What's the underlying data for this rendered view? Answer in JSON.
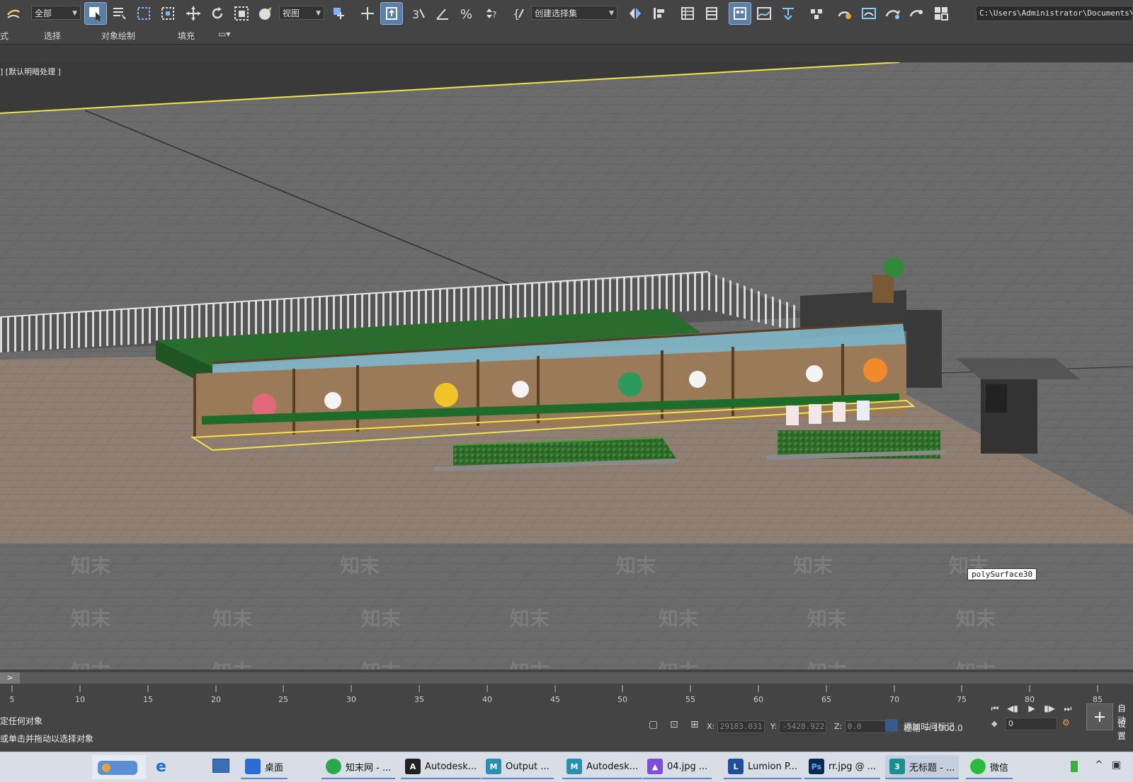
{
  "toolbar": {
    "selection_filter": "全部",
    "reference_coord": "视图",
    "named_selection": "创建选择集",
    "path": "C:\\Users\\Administrator\\Documents\\"
  },
  "ribbon": {
    "items": [
      "式",
      "选择",
      "对象绘制",
      "填充"
    ]
  },
  "viewport": {
    "label": "] [默认明暗处理 ]",
    "tooltip": "polySurface30",
    "watermark": "知末"
  },
  "timeline": {
    "scroll_btn": ">",
    "ticks": [
      "5",
      "10",
      "15",
      "20",
      "25",
      "30",
      "35",
      "40",
      "45",
      "50",
      "55",
      "60",
      "65",
      "70",
      "75",
      "80",
      "85"
    ]
  },
  "status": {
    "line1": "定任何对象",
    "line2": "或单击并拖动以选择对象",
    "x_label": "X:",
    "x_value": "29183.031",
    "y_label": "Y:",
    "y_value": "-5428.922",
    "z_label": "Z:",
    "z_value": "0.0",
    "grid": "栅格 = 1000.0",
    "add_time_tag": "添加时间标记",
    "frame": "0",
    "auto_key": "自动",
    "set_key": "设置"
  },
  "taskbar": {
    "items": [
      {
        "label": "桌面",
        "icon": "desktop-icon",
        "color": "#2b6cd6"
      },
      {
        "label": "知末网 - ...",
        "icon": "browser-icon",
        "color": "#2aa84a"
      },
      {
        "label": "Autodesk...",
        "icon": "autocad-icon",
        "color": "#222222"
      },
      {
        "label": "Output ...",
        "icon": "maya-icon",
        "color": "#2a8fb0"
      },
      {
        "label": "Autodesk...",
        "icon": "maya-icon",
        "color": "#2a8fb0"
      },
      {
        "label": "04.jpg ...",
        "icon": "image-icon",
        "color": "#7d4fd6"
      },
      {
        "label": "Lumion P...",
        "icon": "lumion-icon",
        "color": "#1f4e9a"
      },
      {
        "label": "rr.jpg @ ...",
        "icon": "photoshop-icon",
        "color": "#0b2a52"
      },
      {
        "label": "无标题 - ...",
        "icon": "3dsmax-icon",
        "color": "#1a8f8f"
      },
      {
        "label": "微信",
        "icon": "wechat-icon",
        "color": "#2dbb3c"
      }
    ]
  }
}
